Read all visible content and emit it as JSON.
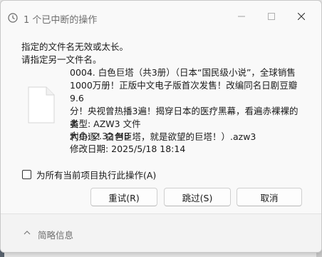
{
  "window": {
    "title": "1 个已中断的操作",
    "controls": {
      "minimize_icon": "minimize-icon",
      "maximize_icon": "maximize-icon",
      "close_icon": "close-icon"
    }
  },
  "message": {
    "line1": "指定的文件名无效或太长。",
    "line2": "请指定另一文件名。"
  },
  "file": {
    "name_line1": "0004. 白色巨塔（共3册）（日本“国民级小说”，全球销售",
    "name_line2": "1000万册！正版中文电子版首次发售！改编同名日剧豆瓣9.6",
    "name_line3": "分！央视曾热播3遍！揭穿日本的医疗黑幕，看遍赤裸裸的名",
    "name_line4": "利角逐！白色巨塔，就是欲望的巨塔！）.azw3",
    "type": "类型: AZW3 文件",
    "size": "大小: 2.32 MB",
    "modified": "修改日期: 2025/5/18 18:14"
  },
  "options": {
    "apply_all_label": "为所有当前项目执行此操作(A)",
    "apply_all_checked": false
  },
  "buttons": {
    "retry": "重试(R)",
    "skip": "跳过(S)",
    "cancel": "取消"
  },
  "footer": {
    "details_label": "简略信息"
  },
  "colors": {
    "dialog_bg": "#f9f9f9",
    "footer_bg": "#f3f3f3",
    "title_text": "#6e6e6e"
  }
}
